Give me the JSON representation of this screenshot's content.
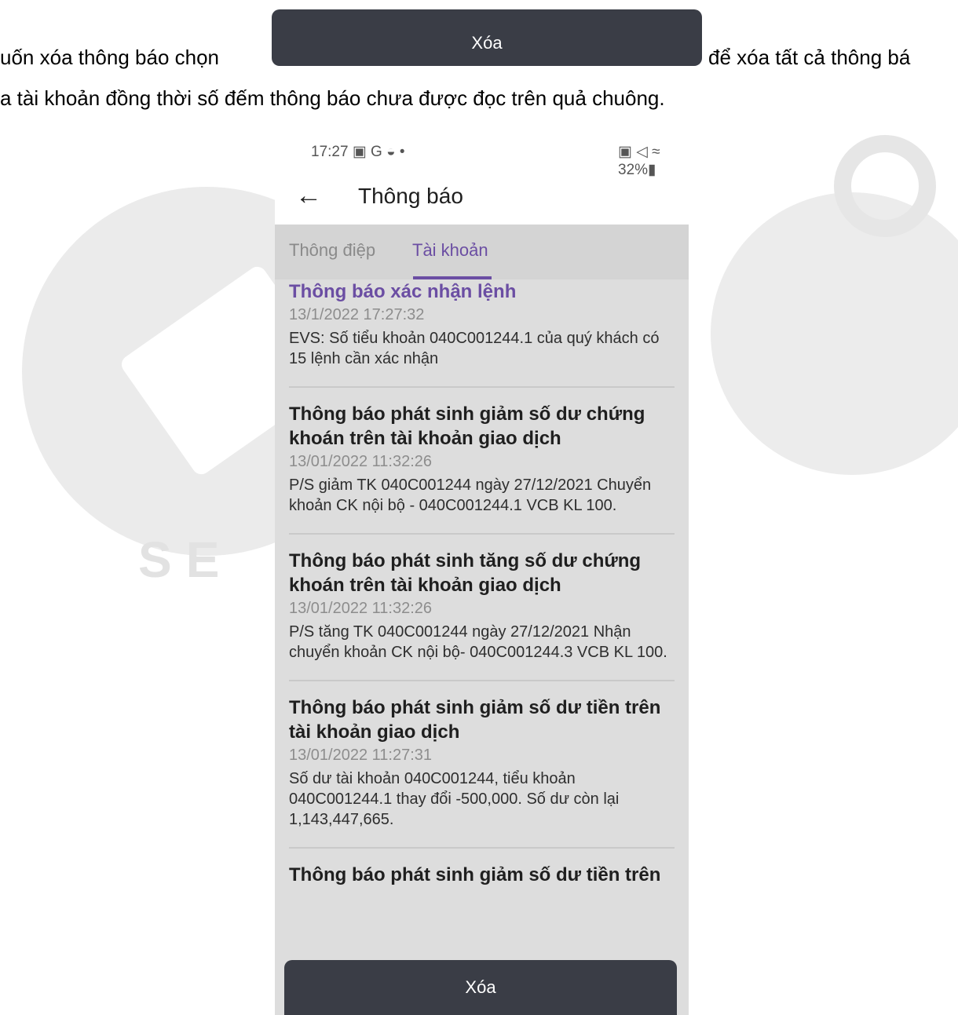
{
  "instructions": {
    "line1_left": "uốn xóa thông báo chọn",
    "inline_button_label": "Xóa",
    "line1_right": "để xóa tất cả thông bá",
    "line2": "a tài khoản đồng thời số đếm thông báo chưa được đọc trên quả chuông."
  },
  "watermark": {
    "text": "SE"
  },
  "status_bar": {
    "time": "17:27 ▣ G ◒ •",
    "right": "▣ ◁ ≈ 32%▮"
  },
  "header": {
    "back_icon": "←",
    "title": "Thông báo"
  },
  "tabs": [
    {
      "label": "Thông điệp",
      "active": false
    },
    {
      "label": "Tài khoản",
      "active": true
    }
  ],
  "notifications": [
    {
      "title": "Thông báo xác nhận lệnh",
      "time": "13/1/2022 17:27:32",
      "body": "EVS: Số tiểu khoản 040C001244.1 của quý khách có 15 lệnh cần xác nhận",
      "unread": true
    },
    {
      "title": "Thông báo phát sinh giảm số dư chứng khoán trên tài khoản giao dịch",
      "time": "13/01/2022 11:32:26",
      "body": "P/S giảm TK 040C001244 ngày 27/12/2021 Chuyển khoản CK nội bộ - 040C001244.1 VCB KL 100.",
      "unread": false
    },
    {
      "title": "Thông báo phát sinh tăng số dư chứng khoán trên tài khoản giao dịch",
      "time": "13/01/2022 11:32:26",
      "body": "P/S tăng TK 040C001244 ngày 27/12/2021 Nhận chuyển khoản CK nội bộ- 040C001244.3 VCB KL 100.",
      "unread": false
    },
    {
      "title": "Thông báo phát sinh giảm số dư tiền trên tài khoản giao dịch",
      "time": "13/01/2022 11:27:31",
      "body": "Số dư tài khoản 040C001244, tiểu khoản 040C001244.1 thay đổi -500,000. Số dư còn lại 1,143,447,665.",
      "unread": false
    },
    {
      "title": "Thông báo phát sinh giảm số dư tiền trên",
      "time": "",
      "body": "",
      "unread": false
    }
  ],
  "bottom_button_label": "Xóa",
  "colors": {
    "accent": "#6b4ea3",
    "button": "#3a3d46",
    "list_background": "#dddddd"
  }
}
